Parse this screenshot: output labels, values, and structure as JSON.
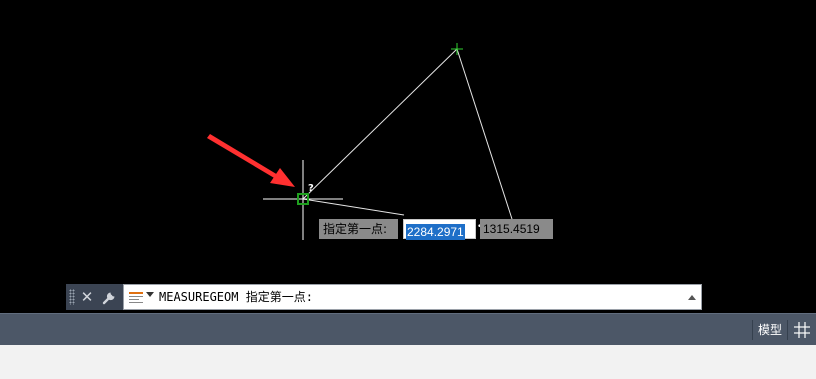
{
  "canvas": {
    "background": "#000000",
    "crosshair_color": "#ffffff",
    "pickbox_color": "#1fa01f",
    "vertex_marker_color": "#2fd12f",
    "arrow_color": "#ff3030",
    "cursor_badge": "?"
  },
  "dynamic_input": {
    "prompt": "指定第一点:",
    "x_value": "2284.2971",
    "y_value": "1315.4519"
  },
  "command_line": {
    "text": "MEASUREGEOM 指定第一点:",
    "icons": [
      "grip-handle-icon",
      "close-icon",
      "wrench-icon",
      "command-history-icon",
      "dropdown-arrow-icon",
      "scroll-up-icon"
    ]
  },
  "status_bar": {
    "model_label": "模型",
    "grid_icon": "grid-icon"
  }
}
